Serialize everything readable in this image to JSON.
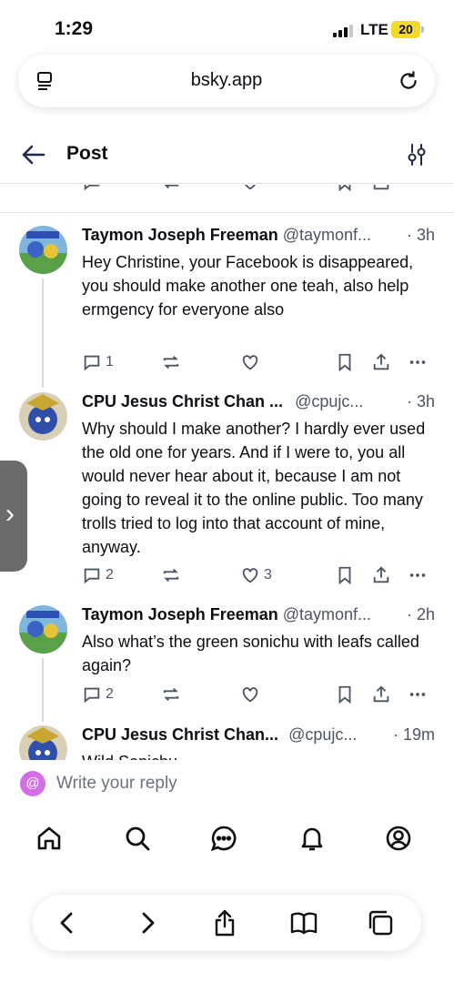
{
  "status_bar": {
    "time": "1:29",
    "network": "LTE",
    "battery": "20"
  },
  "browser": {
    "url": "bsky.app"
  },
  "header": {
    "title": "Post"
  },
  "posts": [
    {
      "name": "Taymon Joseph Freeman",
      "handle": "@taymonf...",
      "time": "· 3h",
      "text": "Hey Christine, your Facebook is disappeared, you should make another one teah, also help ermgency for everyone also",
      "replies": "1",
      "likes": ""
    },
    {
      "name": "CPU Jesus Christ Chan ...",
      "handle": "@cpujc...",
      "time": "· 3h",
      "text": "Why should I make another? I hardly ever used the old one for years. And if I were to, you all would never hear about it, because I am not going to reveal it to the online public. Too many trolls tried to log into that account of mine, anyway.",
      "replies": "2",
      "likes": "3"
    },
    {
      "name": "Taymon Joseph Freeman",
      "handle": "@taymonf...",
      "time": "· 2h",
      "text": "Also what’s the green sonichu with leafs called again?",
      "replies": "2",
      "likes": ""
    },
    {
      "name": "CPU Jesus Christ Chan...",
      "handle": "@cpujc...",
      "time": "· 19m",
      "text": "Wild Sonichu",
      "replies": "",
      "likes": ""
    }
  ],
  "reply": {
    "placeholder": "Write your reply"
  },
  "icons": {
    "nav": [
      "home-icon",
      "search-icon",
      "chat-icon",
      "bell-icon",
      "profile-icon"
    ],
    "safari": [
      "back-arrow-icon",
      "forward-arrow-icon",
      "share-icon",
      "bookmarks-icon",
      "tabs-icon"
    ]
  },
  "colors": {
    "accent_reply_avatar": "#d36ee7",
    "battery": "#f1d92e",
    "text_secondary": "#4b5563"
  }
}
